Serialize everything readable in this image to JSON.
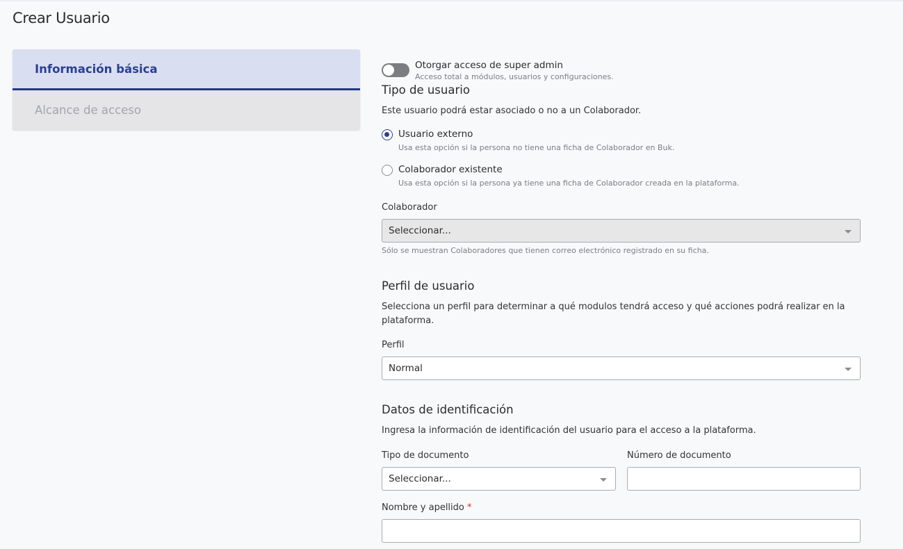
{
  "page": {
    "title": "Crear Usuario"
  },
  "tabs": [
    {
      "label": "Información básica",
      "active": true
    },
    {
      "label": "Alcance de acceso",
      "active": false
    }
  ],
  "super_admin": {
    "label": "Otorgar acceso de super admin",
    "help": "Acceso total a módulos, usuarios y configuraciones.",
    "enabled": false
  },
  "user_type": {
    "title": "Tipo de usuario",
    "description": "Este usuario podrá estar asociado o no a un Colaborador.",
    "options": [
      {
        "label": "Usuario externo",
        "help": "Usa esta opción si la persona no tiene una ficha de Colaborador en Buk.",
        "selected": true
      },
      {
        "label": "Colaborador existente",
        "help": "Usa esta opción si la persona ya tiene una ficha de Colaborador creada en la plataforma.",
        "selected": false
      }
    ],
    "collaborator_label": "Colaborador",
    "collaborator_value": "Seleccionar...",
    "collaborator_help": "Sólo se muestran Colaboradores que tienen correo electrónico registrado en su ficha."
  },
  "profile": {
    "title": "Perfil de usuario",
    "description_line1": "Selecciona un perfil para determinar a qué modulos tendrá acceso y qué acciones podrá realizar en la",
    "description_line2": "plataforma.",
    "field_label": "Perfil",
    "value": "Normal"
  },
  "identification": {
    "title": "Datos de identificación",
    "description": "Ingresa la información de identificación del usuario para el acceso a la plataforma.",
    "doc_type_label": "Tipo de documento",
    "doc_type_value": "Seleccionar...",
    "doc_number_label": "Número de documento",
    "doc_number_value": "",
    "name_label": "Nombre y apellido",
    "name_required_mark": "*",
    "name_value": ""
  },
  "colors": {
    "accent": "#2b3f94",
    "active_tab_bg": "#d9dff0",
    "inactive_tab_bg": "#e5e5e7",
    "required": "#d0342c"
  }
}
